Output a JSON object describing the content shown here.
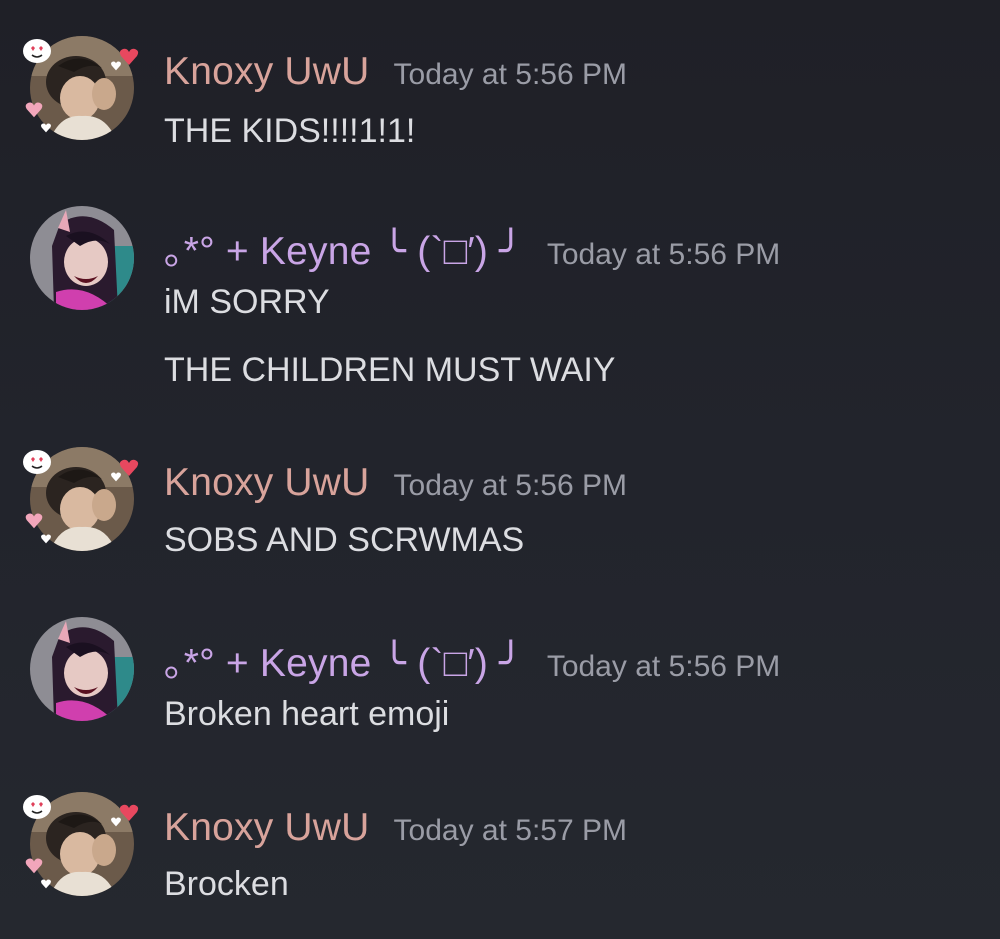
{
  "colors": {
    "background": "#1f2027",
    "text": "#dcdde1",
    "timestamp": "#9a9ca6",
    "knoxy_name": "#d8a39b",
    "keyne_name": "#c9a5e6"
  },
  "messages": [
    {
      "author": "Knoxy UwU",
      "timestamp": "Today at 5:56 PM",
      "avatar": "knoxy-avatar",
      "lines": [
        "THE KIDS!!!!1!1!"
      ]
    },
    {
      "author": "｡*° + Keyne ╰ (`□′) ╯",
      "timestamp": "Today at 5:56 PM",
      "avatar": "keyne-avatar",
      "lines": [
        "iM SORRY",
        "THE CHILDREN MUST WAIY"
      ]
    },
    {
      "author": "Knoxy UwU",
      "timestamp": "Today at 5:56 PM",
      "avatar": "knoxy-avatar",
      "lines": [
        "SOBS AND SCRWMAS"
      ]
    },
    {
      "author": "｡*° + Keyne ╰ (`□′) ╯",
      "timestamp": "Today at 5:56 PM",
      "avatar": "keyne-avatar",
      "lines": [
        "Broken heart emoji"
      ]
    },
    {
      "author": "Knoxy UwU",
      "timestamp": "Today at 5:57 PM",
      "avatar": "knoxy-avatar",
      "lines": [
        "Brocken"
      ]
    }
  ]
}
